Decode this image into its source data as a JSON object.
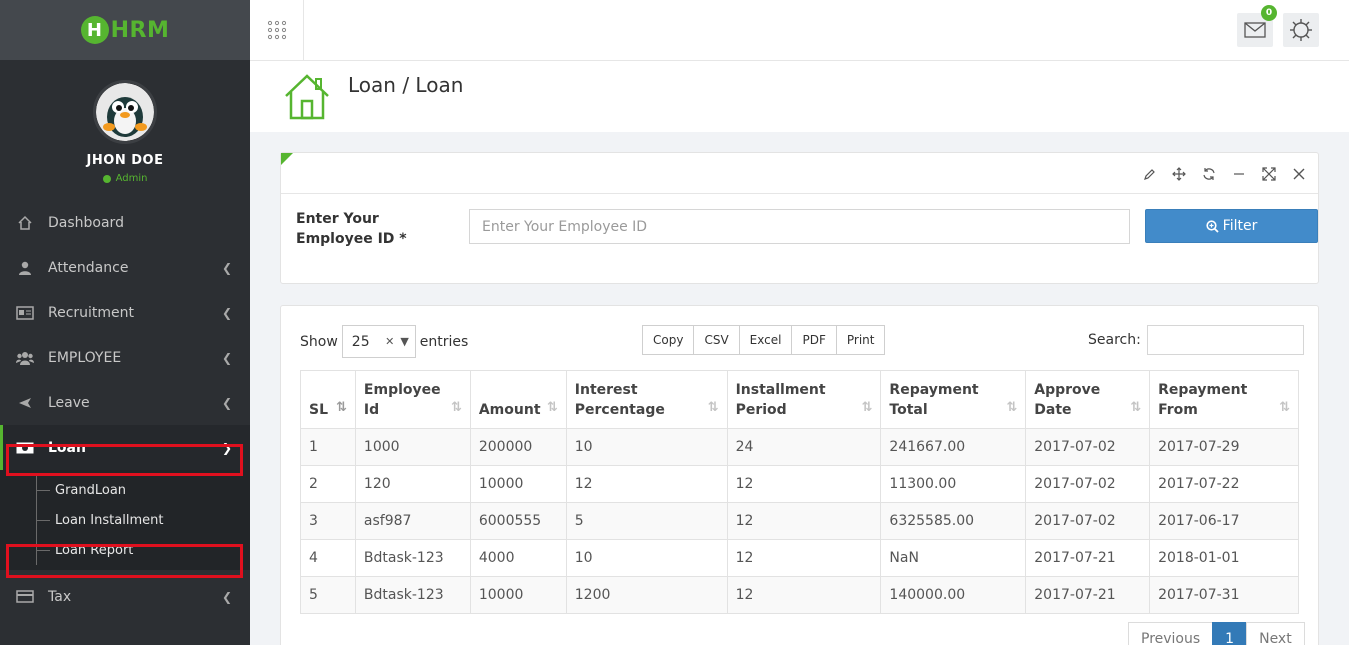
{
  "app": {
    "logo_text": "HRM",
    "logo_mark": "H"
  },
  "user": {
    "name": "JHON DOE",
    "role": "Admin"
  },
  "sidebar": {
    "items": [
      {
        "label": "Dashboard",
        "icon": "home-icon",
        "has_children": false
      },
      {
        "label": "Attendance",
        "icon": "user-icon",
        "has_children": true
      },
      {
        "label": "Recruitment",
        "icon": "id-card-icon",
        "has_children": true
      },
      {
        "label": "EMPLOYEE",
        "icon": "users-icon",
        "has_children": true
      },
      {
        "label": "Leave",
        "icon": "plane-icon",
        "has_children": true
      },
      {
        "label": "Loan",
        "icon": "money-icon",
        "has_children": true,
        "expanded": true
      },
      {
        "label": "Tax",
        "icon": "credit-card-icon",
        "has_children": true
      }
    ],
    "loan_submenu": [
      "GrandLoan",
      "Loan Installment",
      "Loan Report"
    ]
  },
  "header": {
    "notification_count": "0"
  },
  "page": {
    "breadcrumb": "Loan / Loan"
  },
  "filter": {
    "label": "Enter Your Employee ID *",
    "placeholder": "Enter Your Employee ID",
    "button_label": "Filter"
  },
  "table_controls": {
    "show_label": "Show",
    "entries_label": "entries",
    "page_length": "25",
    "export_buttons": [
      "Copy",
      "CSV",
      "Excel",
      "PDF",
      "Print"
    ],
    "search_label": "Search:"
  },
  "table": {
    "columns": [
      "SL",
      "Employee Id",
      "Amount",
      "Interest Percentage",
      "Installment Period",
      "Repayment Total",
      "Approve Date",
      "Repayment From"
    ],
    "rows": [
      [
        "1",
        "1000",
        "200000",
        "10",
        "24",
        "241667.00",
        "2017-07-02",
        "2017-07-29"
      ],
      [
        "2",
        "120",
        "10000",
        "12",
        "12",
        "11300.00",
        "2017-07-02",
        "2017-07-22"
      ],
      [
        "3",
        "asf987",
        "6000555",
        "5",
        "12",
        "6325585.00",
        "2017-07-02",
        "2017-06-17"
      ],
      [
        "4",
        "Bdtask-123",
        "4000",
        "10",
        "12",
        "NaN",
        "2017-07-21",
        "2018-01-01"
      ],
      [
        "5",
        "Bdtask-123",
        "10000",
        "1200",
        "12",
        "140000.00",
        "2017-07-21",
        "2017-07-31"
      ]
    ]
  },
  "pagination": {
    "previous": "Previous",
    "current": "1",
    "next": "Next"
  },
  "colors": {
    "accent": "#56b530",
    "primary": "#428bca",
    "highlight": "#e0101e",
    "sidebar": "#2c2f33"
  }
}
